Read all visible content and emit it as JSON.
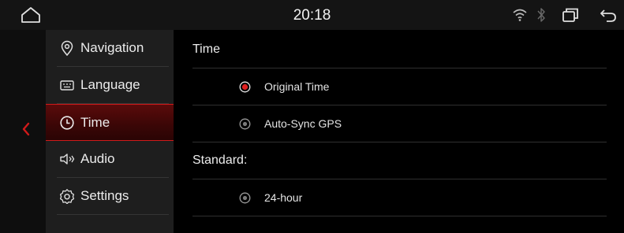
{
  "status_bar": {
    "time": "20:18",
    "icons": [
      "home-icon",
      "wifi-icon",
      "bluetooth-icon",
      "recent-apps-icon",
      "back-icon"
    ]
  },
  "left_strip": {
    "icon": "chevron-left-icon",
    "accent": "#d01a1a"
  },
  "sidebar": {
    "items": [
      {
        "label": "Navigation",
        "icon": "location-pin-icon",
        "active": false
      },
      {
        "label": "Language",
        "icon": "keyboard-icon",
        "active": false
      },
      {
        "label": "Time",
        "icon": "clock-icon",
        "active": true
      },
      {
        "label": "Audio",
        "icon": "speaker-icon",
        "active": false
      },
      {
        "label": "Settings",
        "icon": "gear-icon",
        "active": false
      }
    ]
  },
  "content": {
    "time_section": {
      "title": "Time",
      "options": [
        {
          "label": "Original Time",
          "selected": true
        },
        {
          "label": "Auto-Sync GPS",
          "selected": false
        }
      ]
    },
    "standard_section": {
      "title": "Standard:",
      "options": [
        {
          "label": "24-hour",
          "selected": false
        }
      ]
    }
  },
  "colors": {
    "background": "#000000",
    "panel": "#1e1e1e",
    "accent_red": "#d01a1a",
    "text": "#e8e8e8"
  }
}
